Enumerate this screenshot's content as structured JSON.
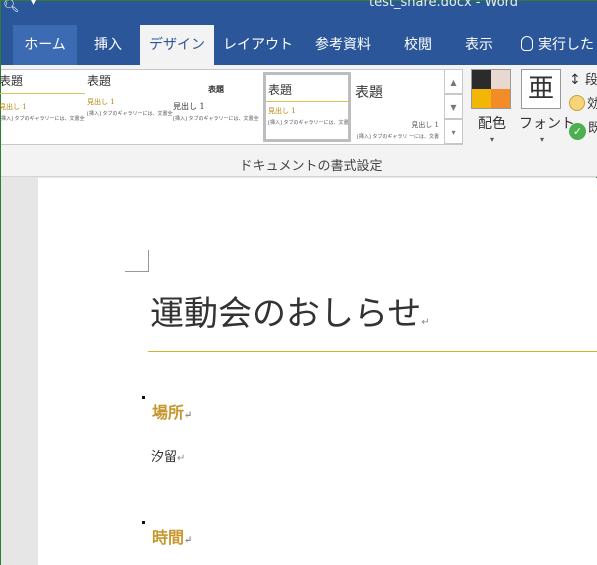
{
  "titlebar": {
    "title": "test_share.docx - Word",
    "qa_icon": "magnifier-icon",
    "qa_arrow": "▾"
  },
  "tabs": [
    {
      "label": "ホーム"
    },
    {
      "label": "挿入"
    },
    {
      "label": "デザイン",
      "active": true
    },
    {
      "label": "レイアウト"
    },
    {
      "label": "参考資料"
    },
    {
      "label": "校閲"
    },
    {
      "label": "表示"
    },
    {
      "label": "実行した"
    }
  ],
  "gallery": {
    "styles": [
      {
        "title": "表題",
        "sub": "見出し 1",
        "body": "[挿入] タブのギャラリーには、文書全体の体裁に合わせて調整するための"
      },
      {
        "title": "表題",
        "sub": "見出し 1",
        "body": "[挿入] タブのギャラリーには、文書全体の体裁に合わせて調整するためのア イテムが含まれています。これらのギ"
      },
      {
        "title": "表題",
        "sub": "見出し 1",
        "body": "[挿入] タブのギャラリーには、文書全体の体裁に合わせて調整するためのアイテムが含まれています"
      },
      {
        "title": "表題",
        "sub": "見出し 1",
        "body": "[挿入] タブのギャラリーには、文書全体の体裁に合わせて調整するためのア"
      },
      {
        "title": "表題",
        "sub": "見出し 1",
        "body": "[挿入] タブのギャラリ ーには、文書"
      }
    ],
    "scroll_up": "▲",
    "scroll_down": "▼",
    "more": "▾"
  },
  "colors_button": {
    "label": "配色",
    "arrow": "▾",
    "swatches": [
      "#2b2b2b",
      "#e8d9d0",
      "#f2b705",
      "#f28c28"
    ]
  },
  "fonts_button": {
    "label": "フォント",
    "glyph": "亜",
    "arrow": "▾"
  },
  "side_items": [
    {
      "label": "段",
      "icon": "paragraph-spacing-icon"
    },
    {
      "label": "効",
      "icon": "effects-icon"
    },
    {
      "label": "既",
      "icon": "set-as-default-icon"
    }
  ],
  "group_label": "ドキュメントの書式設定",
  "document": {
    "title": "運動会のおしらせ",
    "heading_place": "場所",
    "place_text": "汐留",
    "heading_time": "時間",
    "para_mark": "↵",
    "accent_color": "#c7962f",
    "rule_color": "#d4b42a"
  }
}
